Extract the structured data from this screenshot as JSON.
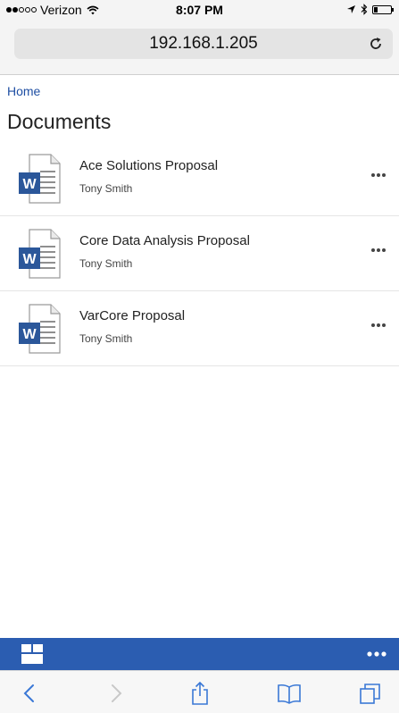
{
  "status_bar": {
    "carrier": "Verizon",
    "time": "8:07 PM",
    "signal_bars": 2,
    "signal_total": 5,
    "battery_level": 0.2
  },
  "address_bar": {
    "url": "192.168.1.205",
    "reload_icon": "reload-icon"
  },
  "breadcrumb": {
    "home_label": "Home"
  },
  "page": {
    "title": "Documents"
  },
  "documents": [
    {
      "title": "Ace Solutions Proposal",
      "author": "Tony Smith",
      "icon": "word-document-icon"
    },
    {
      "title": "Core Data Analysis Proposal",
      "author": "Tony Smith",
      "icon": "word-document-icon"
    },
    {
      "title": "VarCore Proposal",
      "author": "Tony Smith",
      "icon": "word-document-icon"
    }
  ],
  "app_bar": {
    "background": "#2b5db1",
    "left_icon": "apps-tiles-icon",
    "right_icon": "more-ellipsis-icon"
  },
  "safari_toolbar": {
    "buttons": [
      "back-icon",
      "forward-icon",
      "share-icon",
      "bookmarks-icon",
      "tabs-icon"
    ]
  },
  "colors": {
    "accent": "#2b5db1",
    "link": "#1f4fa3",
    "word_blue": "#2b579a"
  }
}
